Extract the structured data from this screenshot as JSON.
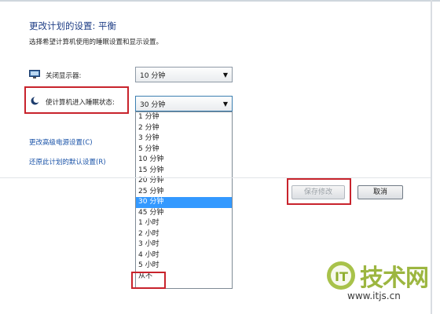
{
  "window": {
    "title": "更改计划的设置: 平衡",
    "subtitle": "选择希望计算机使用的睡眠设置和显示设置。"
  },
  "settings": {
    "display_off_label": "关闭显示器:",
    "display_off_value": "10 分钟",
    "sleep_label": "使计算机进入睡眠状态:",
    "sleep_value": "30 分钟"
  },
  "dropdown": {
    "options": [
      "1 分钟",
      "2 分钟",
      "3 分钟",
      "5 分钟",
      "10 分钟",
      "15 分钟",
      "20 分钟",
      "25 分钟",
      "30 分钟",
      "45 分钟",
      "1 小时",
      "2 小时",
      "3 小时",
      "4 小时",
      "5 小时",
      "从不"
    ],
    "selected": "30 分钟"
  },
  "links": {
    "advanced": "更改高级电源设置(C)",
    "restore": "还原此计划的默认设置(R)"
  },
  "buttons": {
    "save": "保存修改",
    "cancel": "取消"
  },
  "watermark": {
    "title": "技术网",
    "logo_text": "IT",
    "url": "www.itjs.cn"
  },
  "colors": {
    "highlight": "#c8232c",
    "selection": "#3399ff",
    "link": "#1a53a8",
    "watermark_green": "#9cb640"
  },
  "icons": {
    "display": "monitor-icon",
    "sleep": "moon-icon",
    "dropdown_arrow": "chevron-down-icon"
  }
}
